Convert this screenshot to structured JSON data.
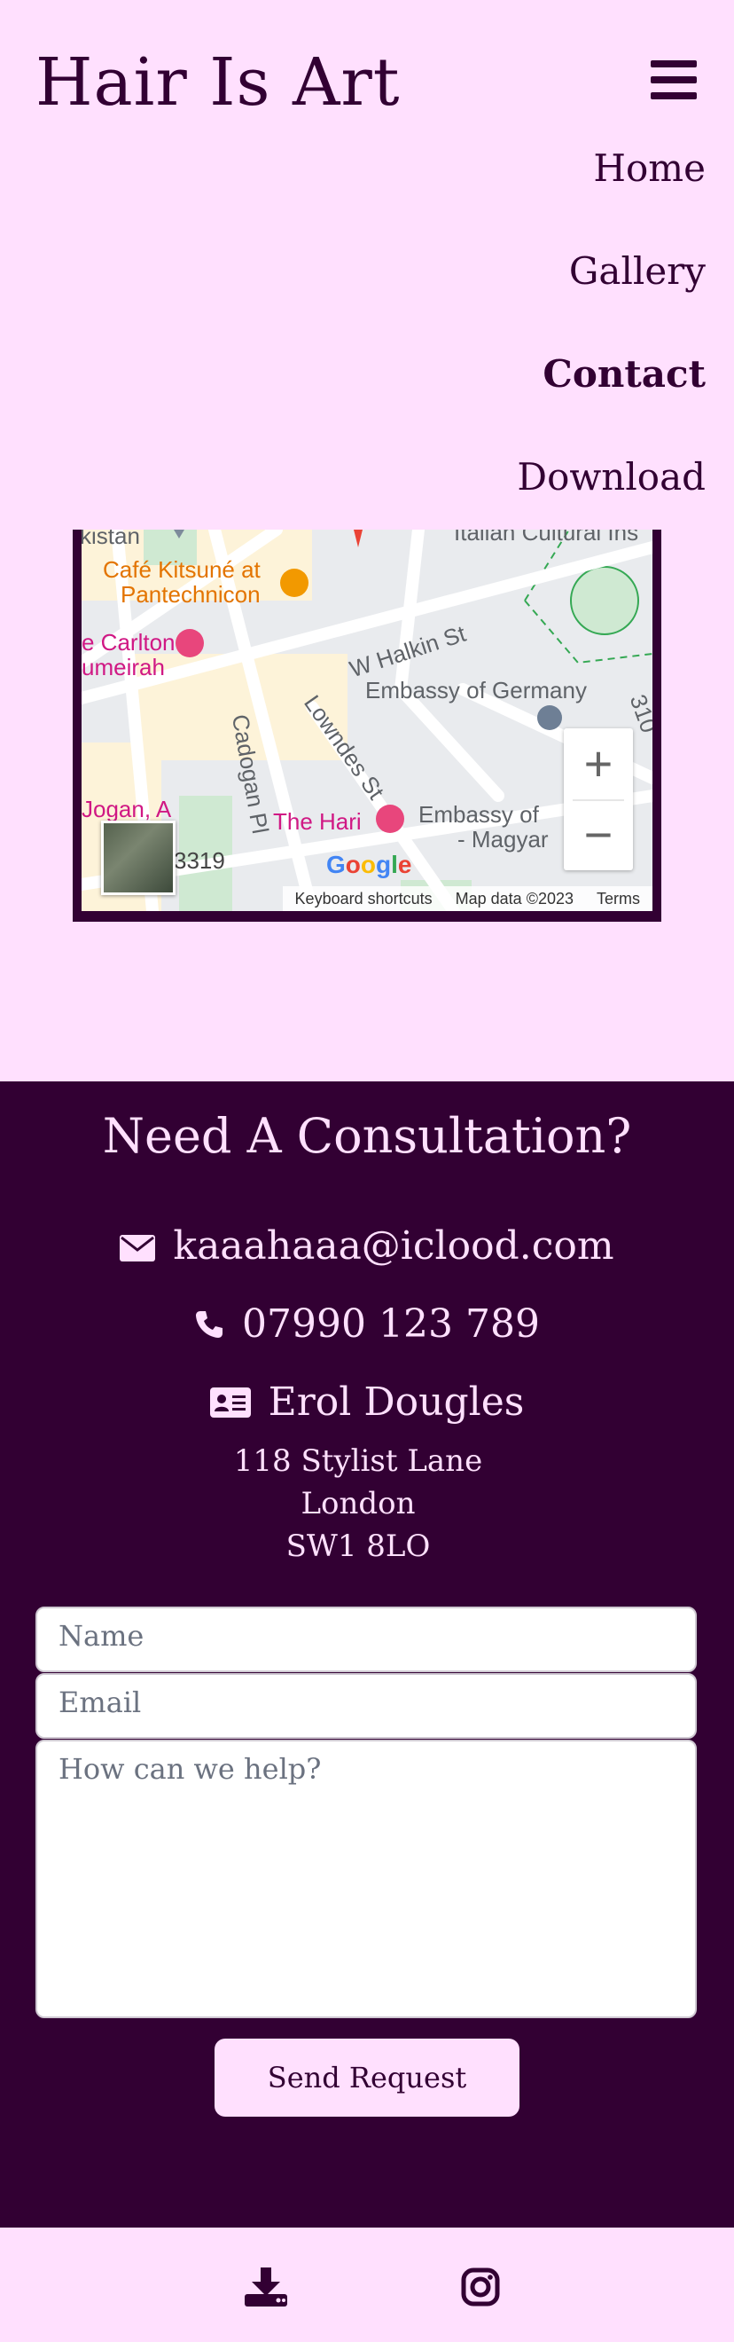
{
  "header": {
    "brand": "Hair Is Art",
    "menu_icon": "hamburger-menu-icon"
  },
  "nav": {
    "items": [
      {
        "label": "Home",
        "active": false
      },
      {
        "label": "Gallery",
        "active": false
      },
      {
        "label": "Contact",
        "active": true
      },
      {
        "label": "Download",
        "active": false
      }
    ]
  },
  "map": {
    "labels": {
      "kistan": "kistan",
      "italian": "Italian Cultural Ins",
      "cafe1": "Café Kitsuné at",
      "cafe2": "Pantechnicon",
      "carlton1": "e Carlton",
      "carlton2": "umeirah",
      "halkin": "W Halkin St",
      "embassy_germany": "Embassy of Germany",
      "lowndes": "Lowndes St",
      "cadogan": "Cadogan Pl",
      "hari": "The Hari",
      "embassy_hungary1": "Embassy of",
      "embassy_hungary2": "- Magyar",
      "jogan": "Jogan, A",
      "b319": "3319",
      "num310": "310"
    },
    "google": "Google",
    "attribution": {
      "shortcuts": "Keyboard shortcuts",
      "data": "Map data ©2023",
      "terms": "Terms"
    },
    "zoom_in": "+",
    "zoom_out": "−"
  },
  "contact": {
    "title": "Need A Consultation?",
    "email": "kaaahaaa@iclood.com",
    "phone": "07990 123 789",
    "name": "Erol Dougles",
    "address": [
      "118 Stylist Lane",
      "London",
      "SW1 8LO"
    ]
  },
  "form": {
    "name_placeholder": "Name",
    "email_placeholder": "Email",
    "message_placeholder": "How can we help?",
    "submit_label": "Send Request"
  },
  "footer": {
    "icons": [
      "download-icon",
      "instagram-icon"
    ]
  },
  "colors": {
    "background": "#ffe0fe",
    "dark": "#320033"
  }
}
